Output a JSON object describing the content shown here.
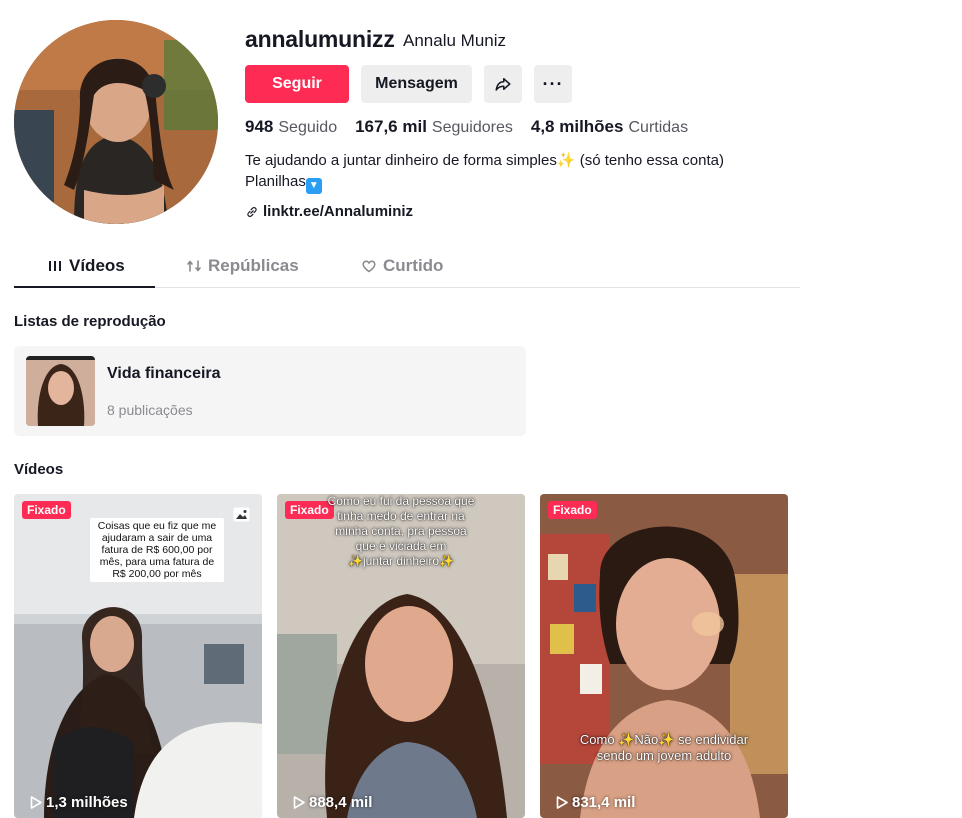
{
  "profile": {
    "username": "annalumunizz",
    "nickname": "Annalu Muniz",
    "follow_label": "Seguir",
    "message_label": "Mensagem",
    "more_label": "···",
    "stats": [
      {
        "value": "948",
        "label": "Seguido"
      },
      {
        "value": "167,6 mil",
        "label": "Seguidores"
      },
      {
        "value": "4,8 milhões",
        "label": "Curtidas"
      }
    ],
    "bio_line1": "Te ajudando a juntar dinheiro de forma simples",
    "bio_line1_end": " (só tenho essa conta)",
    "bio_line2": "Planilhas",
    "sparkle": "✨",
    "link": "linktr.ee/Annaluminiz"
  },
  "tabs": [
    {
      "label": "Vídeos",
      "active": true
    },
    {
      "label": "Repúblicas",
      "active": false
    },
    {
      "label": "Curtido",
      "active": false
    }
  ],
  "playlists": {
    "title": "Listas de reprodução",
    "items": [
      {
        "title": "Vida financeira",
        "count": "8 publicações"
      }
    ]
  },
  "videos": {
    "title": "Vídeos",
    "items": [
      {
        "pinned": "Fixado",
        "views": "1,3 milhões",
        "caption": "Coisas que eu fiz que  me ajudaram a sair de uma fatura de R$ 600,00 por mês, para uma fatura de R$ 200,00 por mês"
      },
      {
        "pinned": "Fixado",
        "views": "888,4 mil",
        "caption_l1": "Como eu fui da pessoa  que",
        "caption_l2": "tinha medo de entrar na",
        "caption_l3": "minha conta, pra pessoa",
        "caption_l4": "que é viciada em",
        "caption_l5": "✨juntar dinheiro✨"
      },
      {
        "pinned": "Fixado",
        "views": "831,4 mil",
        "caption_l1": "Como ✨Não✨ se endividar",
        "caption_l2": "sendo um jovem adulto"
      }
    ]
  },
  "colors": {
    "accent": "#fe2c55",
    "text": "#161823",
    "muted": "#8a8b91",
    "button_bg": "#eeeeef"
  }
}
